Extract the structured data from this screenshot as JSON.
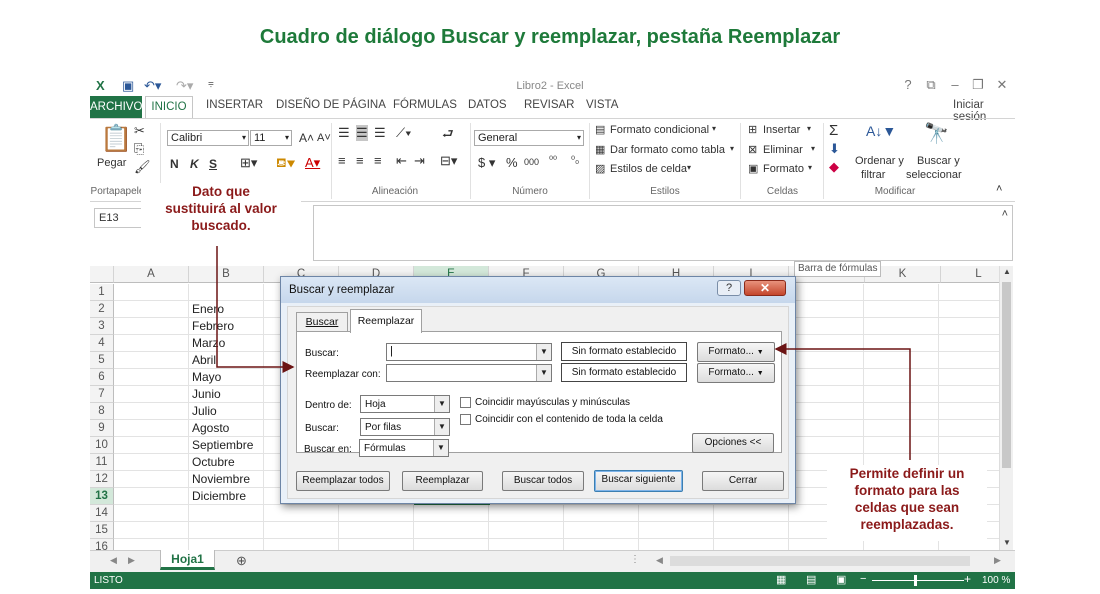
{
  "page_title": "Cuadro de diálogo Buscar y reemplazar, pestaña Reemplazar",
  "window": {
    "title": "Libro2 - Excel",
    "signin": "Iniciar sesión"
  },
  "ribbon_tabs": [
    "ARCHIVO",
    "INICIO",
    "INSERTAR",
    "DISEÑO DE PÁGINA",
    "FÓRMULAS",
    "DATOS",
    "REVISAR",
    "VISTA"
  ],
  "ribbon": {
    "paste_label": "Pegar",
    "font_name": "Calibri",
    "font_size": "11",
    "bold": "N",
    "italic": "K",
    "underline": "S",
    "number_format": "General",
    "cond_format": "Formato condicional",
    "table_format": "Dar formato como tabla",
    "cell_styles": "Estilos de celda",
    "insert": "Insertar",
    "delete": "Eliminar",
    "format": "Formato",
    "sort_filter_1": "Ordenar y",
    "sort_filter_2": "filtrar",
    "find_select_1": "Buscar y",
    "find_select_2": "seleccionar",
    "groups": [
      "Portapapeles",
      "Alineación",
      "Número",
      "Estilos",
      "Celdas",
      "Modificar"
    ]
  },
  "name_box": "E13",
  "formula_tooltip": "Barra de fórmulas",
  "columns": [
    "A",
    "B",
    "C",
    "D",
    "E",
    "F",
    "G",
    "H",
    "I",
    "J",
    "K",
    "L"
  ],
  "rows": [
    "1",
    "2",
    "3",
    "4",
    "5",
    "6",
    "7",
    "8",
    "9",
    "10",
    "11",
    "12",
    "13",
    "14",
    "15",
    "16"
  ],
  "cells_b": [
    "",
    "Enero",
    "Febrero",
    "Marzo",
    "Abril",
    "Mayo",
    "Junio",
    "Julio",
    "Agosto",
    "Septiembre",
    "Octubre",
    "Noviembre",
    "Diciembre",
    "",
    "",
    ""
  ],
  "sheet_tab": "Hoja1",
  "status": {
    "ready": "LISTO",
    "zoom": "100 %"
  },
  "dialog": {
    "title": "Buscar y reemplazar",
    "tab_find": "Buscar",
    "tab_replace": "Reemplazar",
    "find_label": "Buscar:",
    "replace_label": "Reemplazar con:",
    "no_format": "Sin formato establecido",
    "format_btn": "Formato...",
    "within_label": "Dentro de:",
    "within_value": "Hoja",
    "search_label": "Buscar:",
    "search_value": "Por filas",
    "lookin_label": "Buscar en:",
    "lookin_value": "Fórmulas",
    "match_case": "Coincidir mayúsculas y minúsculas",
    "match_entire": "Coincidir con el contenido de toda la celda",
    "options_btn": "Opciones <<",
    "replace_all": "Reemplazar todos",
    "replace": "Reemplazar",
    "find_all": "Buscar todos",
    "find_next": "Buscar siguiente",
    "close": "Cerrar"
  },
  "callouts": {
    "left": [
      "Dato que",
      "sustituirá al valor",
      "buscado."
    ],
    "right": [
      "Permite definir un",
      "formato para las",
      "celdas que sean",
      "reemplazadas."
    ]
  },
  "colors": {
    "excel_green": "#217346",
    "title_green": "#1e7a3a",
    "callout_red": "#8b1a1a"
  }
}
